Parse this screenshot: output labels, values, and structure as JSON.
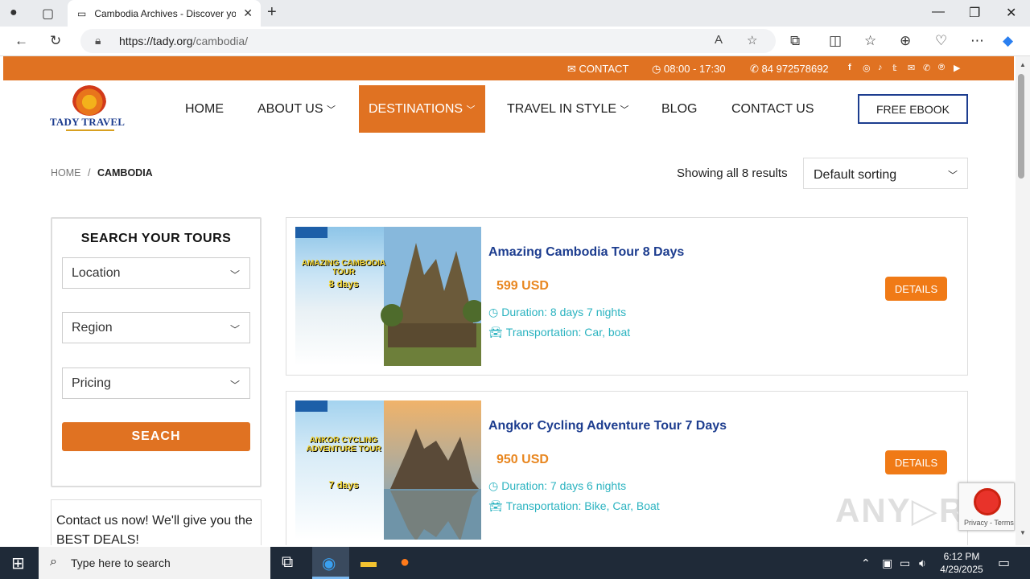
{
  "browser": {
    "tab_title": "Cambodia Archives - Discover yo",
    "url_host": "https://tady.org",
    "url_path": "/cambodia/"
  },
  "topbar": {
    "contact": "CONTACT",
    "hours": "08:00 - 17:30",
    "phone": "84 972578692",
    "social_icons": [
      "facebook-icon",
      "instagram-icon",
      "tiktok-icon",
      "twitter-icon",
      "mail-icon",
      "phone-icon",
      "pinterest-icon",
      "youtube-icon"
    ]
  },
  "logo": {
    "text": "TADY TRAVEL"
  },
  "menu": {
    "items": [
      {
        "label": "HOME"
      },
      {
        "label": "ABOUT US"
      },
      {
        "label": "DESTINATIONS"
      },
      {
        "label": "TRAVEL IN STYLE"
      },
      {
        "label": "BLOG"
      },
      {
        "label": "CONTACT US"
      }
    ],
    "ebook": "FREE EBOOK"
  },
  "breadcrumb": {
    "home": "HOME",
    "sep": "/",
    "current": "CAMBODIA"
  },
  "results": {
    "text": "Showing all 8 results",
    "sort": "Default sorting"
  },
  "sidebar": {
    "title": "SEARCH YOUR TOURS",
    "location": "Location",
    "region": "Region",
    "pricing": "Pricing",
    "button": "SEACH",
    "contact_text": "Contact us now! We'll give you the BEST DEALS!"
  },
  "tours": [
    {
      "title": "Amazing Cambodia Tour 8 Days",
      "price": "599 USD",
      "duration": "Duration: 8 days 7 nights",
      "transport": "Transportation: Car, boat",
      "details": "DETAILS",
      "thumb_line1": "AMAZING CAMBODIA TOUR",
      "thumb_line2": "8 days"
    },
    {
      "title": "Angkor Cycling Adventure Tour 7 Days",
      "price": "950 USD",
      "duration": "Duration: 7 days 6 nights",
      "transport": "Transportation: Bike, Car, Boat",
      "details": "DETAILS",
      "thumb_line1": "ANKOR CYCLING ADVENTURE TOUR",
      "thumb_line2": "7 days"
    }
  ],
  "recaptcha": {
    "text": "Privacy - Terms"
  },
  "taskbar": {
    "search_placeholder": "Type here to search",
    "time": "6:12 PM",
    "date": "4/29/2025"
  },
  "colors": {
    "accent": "#e07222",
    "navy": "#1d3d8f",
    "teal": "#2bb3c0",
    "price": "#e8861f"
  }
}
